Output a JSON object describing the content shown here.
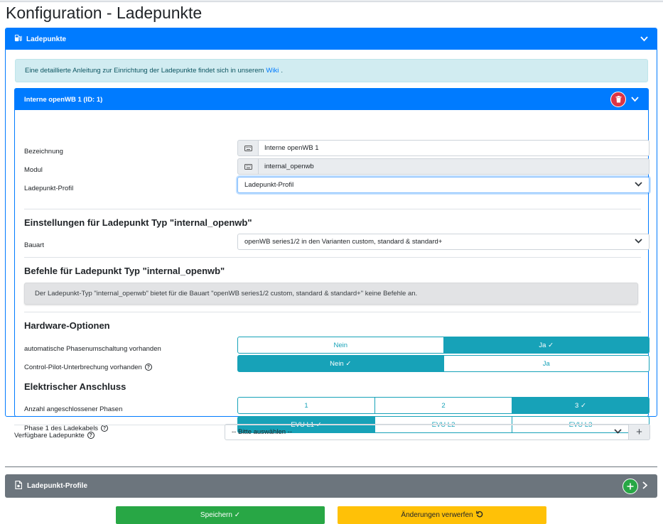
{
  "page": {
    "title": "Konfiguration - Ladepunkte"
  },
  "colors": {
    "primary": "#007bff",
    "info": "#17a2b8",
    "danger": "#dc3545",
    "success": "#28a745",
    "warning": "#ffc107",
    "secondary": "#6c757d"
  },
  "ladepunkte_card": {
    "title": "Ladepunkte",
    "icon": "charging-station-icon",
    "info_text": "Eine detaillierte Anleitung zur Einrichtung der Ladepunkte findet sich in unserem",
    "info_link": "Wiki",
    "info_suffix": "."
  },
  "chargepoint": {
    "header": "Interne openWB 1 (ID: 1)",
    "bezeichnung": {
      "label": "Bezeichnung",
      "value": "Interne openWB 1"
    },
    "modul": {
      "label": "Modul",
      "value": "internal_openwb"
    },
    "profil": {
      "label": "Ladepunkt-Profil",
      "value": "Ladepunkt-Profil"
    }
  },
  "einstellungen": {
    "heading": "Einstellungen für Ladepunkt Typ \"internal_openwb\"",
    "bauart": {
      "label": "Bauart",
      "value": "openWB series1/2 in den Varianten custom, standard & standard+"
    }
  },
  "befehle": {
    "heading": "Befehle für Ladepunkt Typ \"internal_openwb\"",
    "text": "Der Ladepunkt-Typ \"internal_openwb\" bietet für die Bauart \"openWB series1/2 custom, standard & standard+\" keine Befehle an."
  },
  "hardware": {
    "heading": "Hardware-Optionen",
    "phasenumschaltung": {
      "label": "automatische Phasenumschaltung vorhanden",
      "no": "Nein",
      "yes": "Ja ✓",
      "selected": "yes"
    },
    "cp_unterbrechung": {
      "label": "Control-Pilot-Unterbrechung vorhanden",
      "no": "Nein ✓",
      "yes": "Ja",
      "selected": "no"
    }
  },
  "anschluss": {
    "heading": "Elektrischer Anschluss",
    "phasen": {
      "label": "Anzahl angeschlossener Phasen",
      "options": [
        "1",
        "2",
        "3 ✓"
      ],
      "selected": 2
    },
    "phase1": {
      "label": "Phase 1 des Ladekabels",
      "options": [
        "EVU L1 ✓",
        "EVU L2",
        "EVU L3"
      ],
      "selected": 0
    }
  },
  "verfuegbar": {
    "label": "Verfügbare Ladepunkte",
    "placeholder": "-- Bitte auswählen --"
  },
  "profile_card": {
    "title": "Ladepunkt-Profile"
  },
  "actions": {
    "save": "Speichern ✓",
    "discard": "Änderungen verwerfen"
  }
}
